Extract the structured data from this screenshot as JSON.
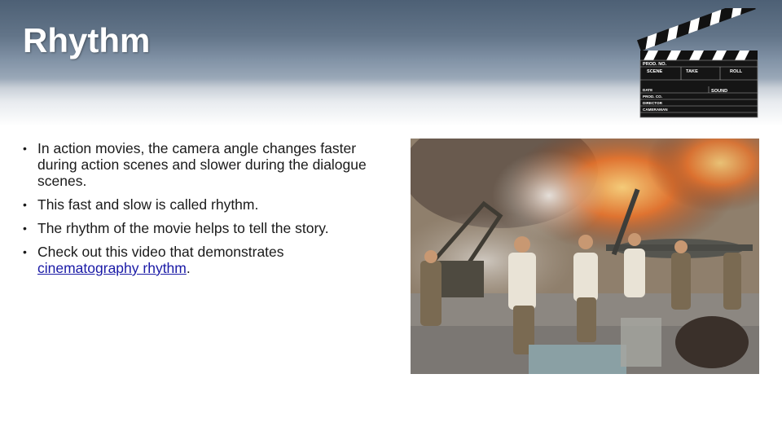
{
  "slide": {
    "title": "Rhythm",
    "bullets": [
      "In action movies, the camera angle changes faster during action scenes and slower during the dialogue scenes.",
      "This fast and slow is called rhythm.",
      "The rhythm of the movie helps to tell the story."
    ],
    "last_bullet": {
      "prefix": "Check out this video that demonstrates ",
      "link_text": "cinematography rhythm",
      "suffix": "."
    },
    "bullet_glyph": "•"
  },
  "clapperboard": {
    "labels": {
      "prod_no": "PROD. NO.",
      "scene": "SCENE",
      "take": "TAKE",
      "roll": "ROLL",
      "date": "DATE",
      "sound": "SOUND",
      "prod_co": "PROD. CO.",
      "director": "DIRECTOR",
      "cameraman": "CAMERAMAN"
    }
  },
  "colors": {
    "header_top": "#4d6075",
    "title_text": "#ffffff",
    "body_text": "#1a1a1a",
    "link": "#1a1aa6"
  }
}
